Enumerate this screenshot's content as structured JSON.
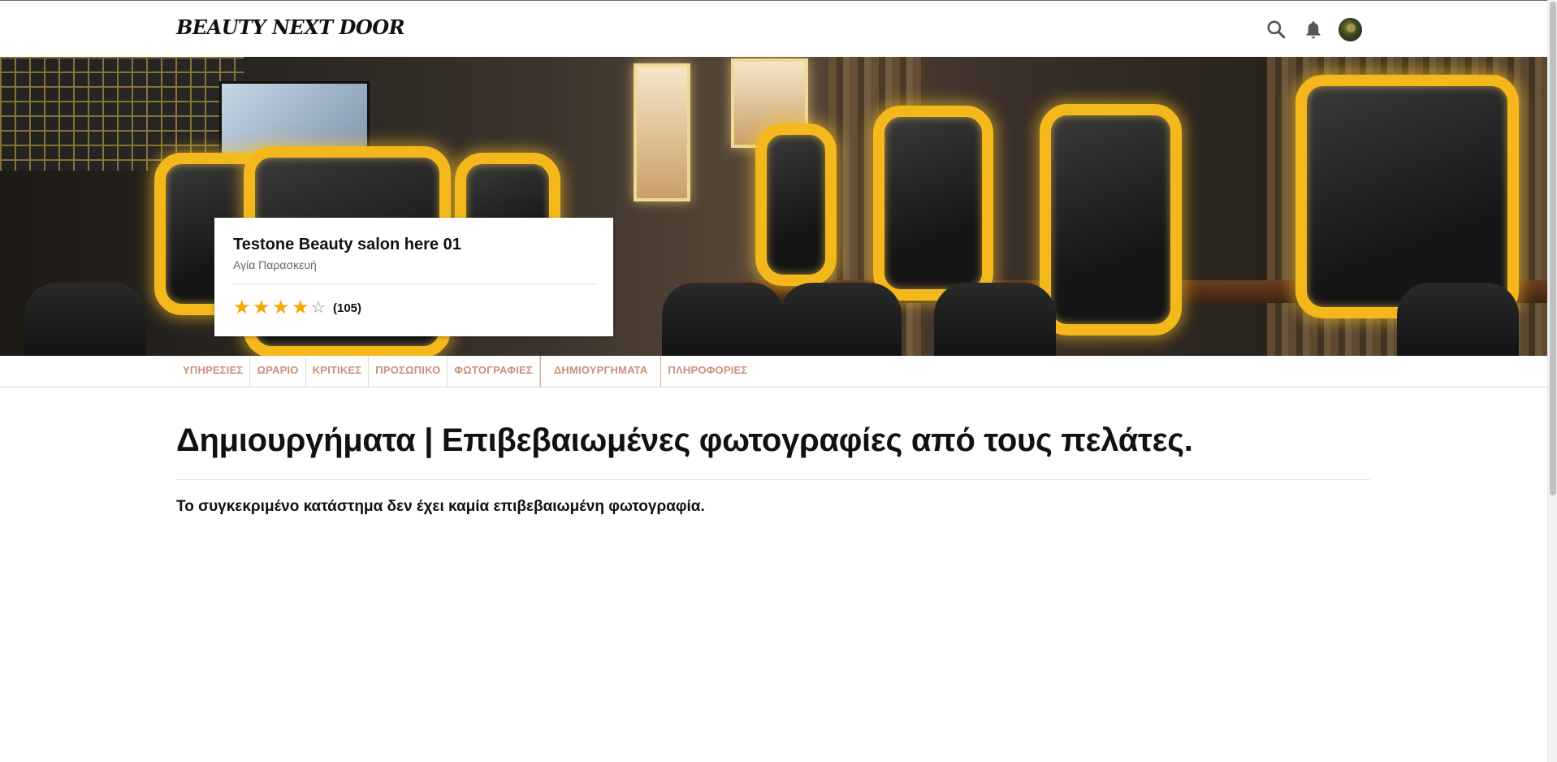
{
  "header": {
    "logo": "BEAUTY NEXT DOOR",
    "icons": [
      "search-icon",
      "bell-icon",
      "avatar"
    ]
  },
  "salon": {
    "name": "Testone Beauty salon here 01",
    "location": "Αγία Παρασκευή",
    "rating": 4,
    "rating_max": 5,
    "reviews": "(105)"
  },
  "tabs": [
    {
      "label": "ΥΠΗΡΕΣΙΕΣ",
      "active": false
    },
    {
      "label": "ΩΡΑΡΙΟ",
      "active": false
    },
    {
      "label": "ΚΡΙΤΙΚΕΣ",
      "active": false
    },
    {
      "label": "ΠΡΟΣΩΠΙΚΟ",
      "active": false
    },
    {
      "label": "ΦΩΤΟΓΡΑΦΙΕΣ",
      "active": false
    },
    {
      "label": "ΔΗΜΙΟΥΡΓΗΜΑΤΑ",
      "active": true
    },
    {
      "label": "ΠΛΗΡΟΦΟΡΙΕΣ",
      "active": false
    }
  ],
  "main": {
    "title": "Δημιουργήματα | Επιβεβαιωμένες φωτογραφίες από τους πελάτες.",
    "empty_message": "Το συγκεκριμένο κατάστημα δεν έχει καμία επιβεβαιωμένη φωτογραφία."
  },
  "colors": {
    "star": "#f5a800",
    "tab_text": "#c9907a",
    "mirror_frame": "#f4b81c"
  }
}
